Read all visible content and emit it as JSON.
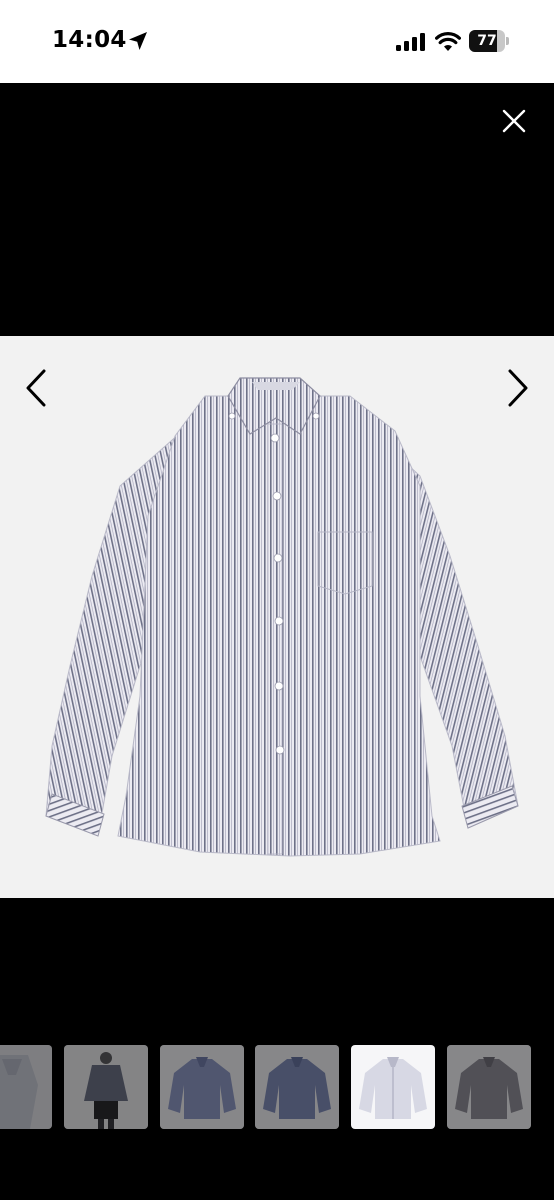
{
  "status_bar": {
    "time": "14:04",
    "battery_level": "77",
    "battery_fraction": 0.77,
    "icons": [
      "location-arrow-icon",
      "cellular-signal-icon",
      "wifi-icon",
      "battery-icon"
    ]
  },
  "viewer": {
    "icons": [
      "close-icon",
      "chevron-left-icon",
      "chevron-right-icon"
    ],
    "main_image": "striped-button-down-shirt",
    "thumbnails": [
      {
        "subject": "shirt-collar-closeup",
        "active": false
      },
      {
        "subject": "model-wearing-shirt",
        "active": false
      },
      {
        "subject": "blue-shirt",
        "active": false
      },
      {
        "subject": "blue-shirt-alt",
        "active": false
      },
      {
        "subject": "white-striped-shirt",
        "active": true
      },
      {
        "subject": "dark-shirt",
        "active": false
      }
    ]
  },
  "colors": {
    "background": "#000000",
    "photo_background": "#f2f2f2",
    "stripe_dark": "#6e7188",
    "stripe_light": "#e7e7ef"
  }
}
